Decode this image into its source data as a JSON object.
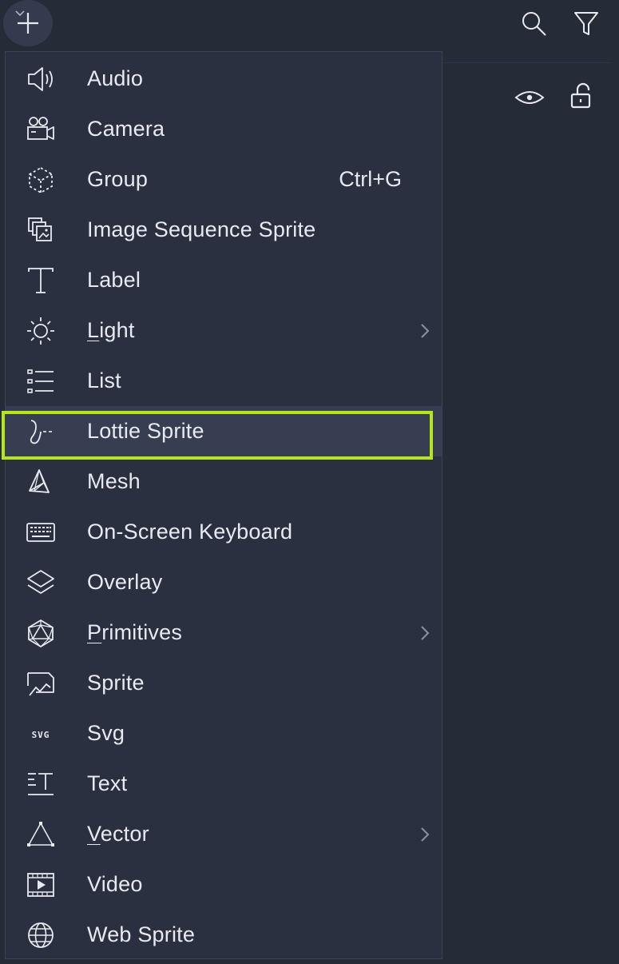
{
  "toolbar": {
    "add_icon": "plus-icon",
    "search_icon": "search-icon",
    "filter_icon": "filter-icon",
    "visibility_icon": "eye-icon",
    "lock_icon": "unlock-icon"
  },
  "menu": {
    "highlight_color": "#b5e61d",
    "items": [
      {
        "label": "Audio",
        "icon": "speaker-icon",
        "shortcut": "",
        "has_submenu": false
      },
      {
        "label": "Camera",
        "icon": "camera-icon",
        "shortcut": "",
        "has_submenu": false
      },
      {
        "label": "Group",
        "icon": "group-icon",
        "shortcut": "Ctrl+G",
        "has_submenu": false
      },
      {
        "label": "Image Sequence Sprite",
        "icon": "image-sequence-icon",
        "shortcut": "",
        "has_submenu": false
      },
      {
        "label": "Label",
        "icon": "label-icon",
        "shortcut": "",
        "has_submenu": false
      },
      {
        "label": "Light",
        "icon": "light-icon",
        "shortcut": "",
        "has_submenu": true
      },
      {
        "label": "List",
        "icon": "list-icon",
        "shortcut": "",
        "has_submenu": false
      },
      {
        "label": "Lottie Sprite",
        "icon": "lottie-icon",
        "shortcut": "",
        "has_submenu": false,
        "selected": true
      },
      {
        "label": "Mesh",
        "icon": "mesh-icon",
        "shortcut": "",
        "has_submenu": false
      },
      {
        "label": "On-Screen Keyboard",
        "icon": "keyboard-icon",
        "shortcut": "",
        "has_submenu": false
      },
      {
        "label": "Overlay",
        "icon": "overlay-icon",
        "shortcut": "",
        "has_submenu": false
      },
      {
        "label": "Primitives",
        "icon": "primitives-icon",
        "shortcut": "",
        "has_submenu": true
      },
      {
        "label": "Sprite",
        "icon": "sprite-icon",
        "shortcut": "",
        "has_submenu": false
      },
      {
        "label": "Svg",
        "icon": "svg-icon",
        "shortcut": "",
        "has_submenu": false
      },
      {
        "label": "Text",
        "icon": "text-icon",
        "shortcut": "",
        "has_submenu": false
      },
      {
        "label": "Vector",
        "icon": "vector-icon",
        "shortcut": "",
        "has_submenu": true
      },
      {
        "label": "Video",
        "icon": "video-icon",
        "shortcut": "",
        "has_submenu": false
      },
      {
        "label": "Web Sprite",
        "icon": "globe-icon",
        "shortcut": "",
        "has_submenu": false
      }
    ]
  }
}
